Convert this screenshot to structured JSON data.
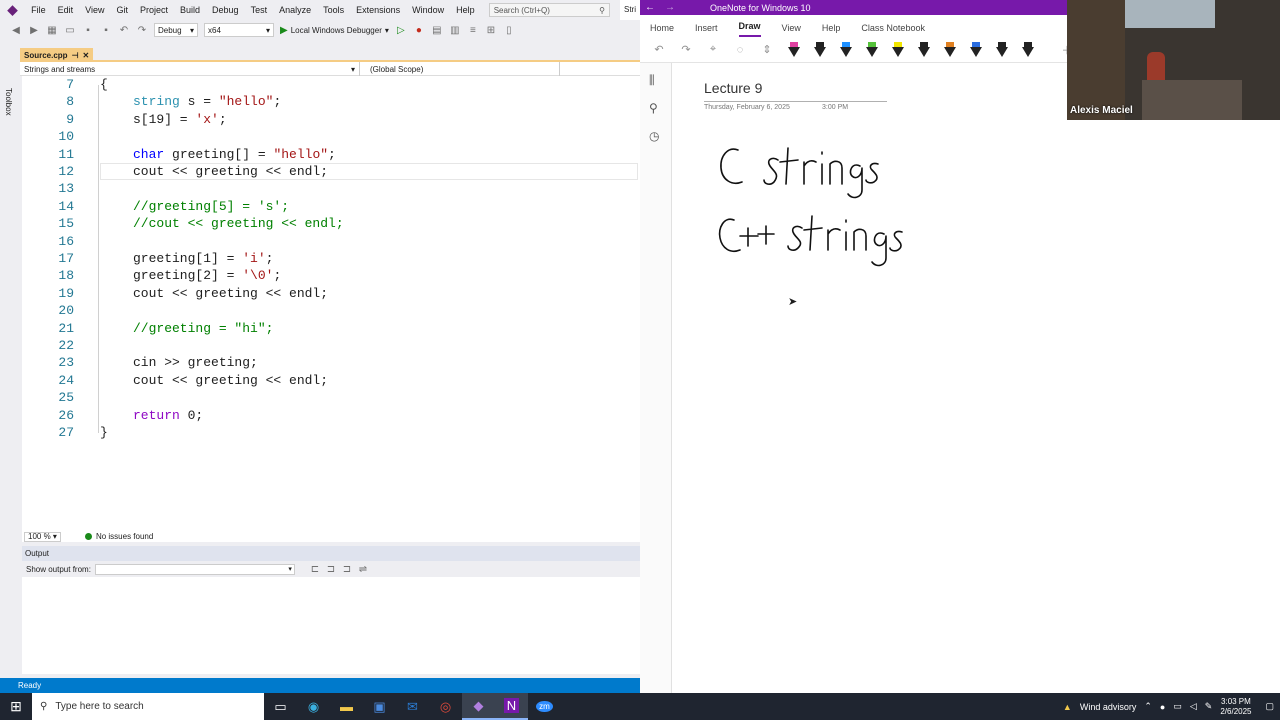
{
  "vs": {
    "menu": [
      "File",
      "Edit",
      "View",
      "Git",
      "Project",
      "Build",
      "Debug",
      "Test",
      "Analyze",
      "Tools",
      "Extensions",
      "Window",
      "Help"
    ],
    "search_placeholder": "Search (Ctrl+Q)",
    "title_fragment": "Stri",
    "config": "Debug",
    "platform": "x64",
    "debugger": "Local Windows Debugger",
    "toolbox": "Toolbox",
    "doc_tab": "Source.cpp",
    "nav_project": "Strings and streams",
    "nav_scope": "(Global Scope)",
    "code_lines": [
      {
        "n": "7",
        "html": "<span style='color:#1e1e1e'>{</span>",
        "indent": 0
      },
      {
        "n": "8",
        "html": "<span style='color:#2b91af'>string</span> s = <span style='color:#a31515'>\"hello\"</span>;",
        "indent": 1
      },
      {
        "n": "9",
        "html": "s[19] = <span style='color:#a31515'>'x'</span>;",
        "indent": 1
      },
      {
        "n": "10",
        "html": "",
        "indent": 1
      },
      {
        "n": "11",
        "html": "<span style='color:#0000ff'>char</span> greeting[] = <span style='color:#a31515'>\"hello\"</span>;",
        "indent": 1
      },
      {
        "n": "12",
        "html": "cout &lt;&lt; greeting &lt;&lt; endl;",
        "indent": 1
      },
      {
        "n": "13",
        "html": "",
        "indent": 1
      },
      {
        "n": "14",
        "html": "<span style='color:#008000'>//greeting[5] = 's';</span>",
        "indent": 1
      },
      {
        "n": "15",
        "html": "<span style='color:#008000'>//cout &lt;&lt; greeting &lt;&lt; endl;</span>",
        "indent": 1
      },
      {
        "n": "16",
        "html": "",
        "indent": 1
      },
      {
        "n": "17",
        "html": "greeting[1] = <span style='color:#a31515'>'i'</span>;",
        "indent": 1
      },
      {
        "n": "18",
        "html": "greeting[2] = <span style='color:#a31515'>'\\0'</span>;",
        "indent": 1
      },
      {
        "n": "19",
        "html": "cout &lt;&lt; greeting &lt;&lt; endl;",
        "indent": 1
      },
      {
        "n": "20",
        "html": "",
        "indent": 1
      },
      {
        "n": "21",
        "html": "<span style='color:#008000'>//greeting = \"hi\";</span>",
        "indent": 1
      },
      {
        "n": "22",
        "html": "",
        "indent": 1
      },
      {
        "n": "23",
        "html": "cin &gt;&gt; greeting;",
        "indent": 1
      },
      {
        "n": "24",
        "html": "cout &lt;&lt; greeting &lt;&lt; endl;",
        "indent": 1
      },
      {
        "n": "25",
        "html": "",
        "indent": 1
      },
      {
        "n": "26",
        "html": "<span style='color:#8f08c4'>return</span> 0;",
        "indent": 1
      },
      {
        "n": "27",
        "html": "}",
        "indent": 0
      }
    ],
    "zoom": "100 %",
    "issues": "No issues found",
    "output_title": "Output",
    "output_from_label": "Show output from:",
    "status": "Ready"
  },
  "onenote": {
    "window_title": "OneNote for Windows 10",
    "tabs": [
      "Home",
      "Insert",
      "Draw",
      "View",
      "Help",
      "Class Notebook"
    ],
    "active_tab": "Draw",
    "pens": [
      "#e040a0",
      "#222222",
      "#1e90ff",
      "#55c23a",
      "#f2e600",
      "#222222",
      "#e08020",
      "#2a6de0",
      "#222222",
      "#222222"
    ],
    "page_title": "Lecture 9",
    "page_date": "Thursday, February 6, 2025",
    "page_time": "3:00 PM",
    "ink_line1": "C strings",
    "ink_line2": "C++ strings"
  },
  "webcam": {
    "name": "Alexis Maciel"
  },
  "taskbar": {
    "search_placeholder": "Type here to search",
    "weather": "Wind advisory",
    "time": "3:03 PM",
    "date": "2/6/2025"
  }
}
